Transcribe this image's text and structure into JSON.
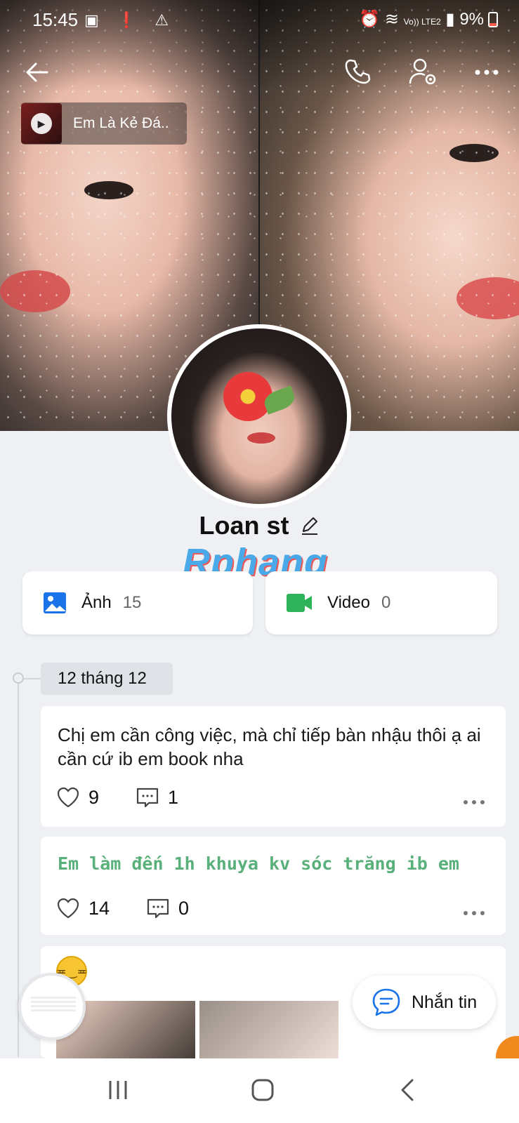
{
  "status_bar": {
    "time": "15:45",
    "network_label": "Vo)) LTE2",
    "battery": "9%"
  },
  "music": {
    "title": "Em Là Kẻ Đá.."
  },
  "profile": {
    "name": "Loan st"
  },
  "watermark": "Rphang",
  "albums": {
    "photos_label": "Ảnh",
    "photos_count": "15",
    "videos_label": "Video",
    "videos_count": "0"
  },
  "timeline": {
    "date": "12 tháng 12",
    "posts": [
      {
        "text": "Chị em cần công việc, mà chỉ tiếp bàn nhậu thôi ạ ai cần cứ ib em book nha",
        "likes": "9",
        "comments": "1"
      },
      {
        "text": "Em làm đến 1h khuya kv sóc trăng ib em",
        "likes": "14",
        "comments": "0"
      }
    ]
  },
  "chat_button": {
    "label": "Nhắn tin"
  },
  "colors": {
    "accent_blue": "#1a73e8",
    "video_green": "#2fb35a",
    "post_green_text": "#5ab07a",
    "background": "#eef0f3"
  },
  "icons": [
    "back-arrow-icon",
    "phone-icon",
    "user-settings-icon",
    "more-icon",
    "play-icon",
    "edit-icon",
    "image-icon",
    "video-camera-icon",
    "heart-icon",
    "comment-icon",
    "chat-icon",
    "recents-icon",
    "home-icon",
    "nav-back-icon"
  ]
}
